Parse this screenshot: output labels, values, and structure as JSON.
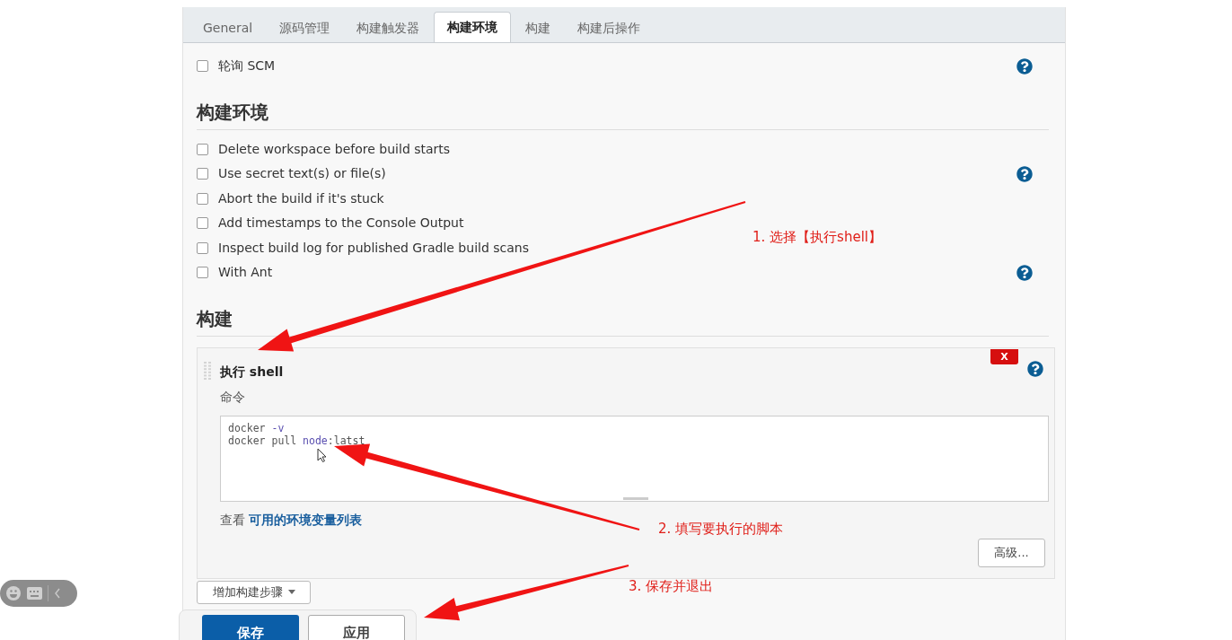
{
  "tabs": [
    {
      "label": "General",
      "selected": false
    },
    {
      "label": "源码管理",
      "selected": false
    },
    {
      "label": "构建触发器",
      "selected": false
    },
    {
      "label": "构建环境",
      "selected": true
    },
    {
      "label": "构建",
      "selected": false
    },
    {
      "label": "构建后操作",
      "selected": false
    }
  ],
  "trigger_options": [
    {
      "label": "轮询 SCM",
      "checked": false,
      "help": true
    }
  ],
  "build_environment": {
    "title": "构建环境",
    "options": [
      {
        "label": "Delete workspace before build starts",
        "checked": false,
        "help": false
      },
      {
        "label": "Use secret text(s) or file(s)",
        "checked": false,
        "help": true
      },
      {
        "label": "Abort the build if it's stuck",
        "checked": false,
        "help": false
      },
      {
        "label": "Add timestamps to the Console Output",
        "checked": false,
        "help": false
      },
      {
        "label": "Inspect build log for published Gradle build scans",
        "checked": false,
        "help": false
      },
      {
        "label": "With Ant",
        "checked": false,
        "help": true
      }
    ]
  },
  "build": {
    "title": "构建",
    "step": {
      "title": "执行 shell",
      "delete_label": "X",
      "command_label": "命令",
      "command_lines": [
        [
          {
            "text": "docker ",
            "kind": "plain"
          },
          {
            "text": "-v",
            "kind": "keyword"
          }
        ],
        [
          {
            "text": "docker pull ",
            "kind": "plain"
          },
          {
            "text": "node",
            "kind": "keyword"
          },
          {
            "text": ":latst",
            "kind": "plain"
          }
        ]
      ],
      "env_prefix": "查看",
      "env_link": "可用的环境变量列表",
      "advanced_button": "高级..."
    },
    "add_step_button": "增加构建步骤"
  },
  "footer_buttons": [
    {
      "label": "保存",
      "kind": "primary"
    },
    {
      "label": "应用",
      "kind": "secondary"
    }
  ],
  "annotations": [
    "1. 选择【执行shell】",
    "2. 填写要执行的脚本",
    "3. 保存并退出"
  ]
}
